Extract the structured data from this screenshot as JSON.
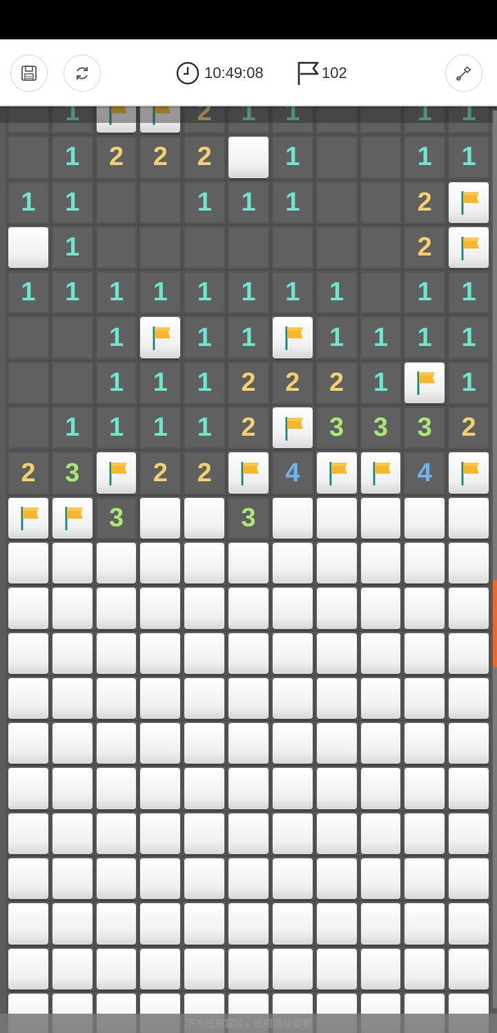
{
  "header": {
    "timer": "10:49:08",
    "flag_count": "102",
    "buttons": [
      {
        "name": "save-button",
        "icon": "save-icon"
      },
      {
        "name": "restart-button",
        "icon": "refresh-icon"
      },
      {
        "name": "shovel-button",
        "icon": "shovel-icon"
      }
    ]
  },
  "board": {
    "columns": 11,
    "legend": "rows: C = unopened, E = opened empty, F = flag, digit = opened number",
    "rows": [
      [
        "E",
        "1",
        "F",
        "F",
        "2",
        "1",
        "1",
        "E",
        "E",
        "1",
        "1"
      ],
      [
        "E",
        "1",
        "2",
        "2",
        "2",
        "C",
        "1",
        "E",
        "E",
        "1",
        "1"
      ],
      [
        "1",
        "1",
        "E",
        "E",
        "1",
        "1",
        "1",
        "E",
        "E",
        "2",
        "F"
      ],
      [
        "C",
        "1",
        "E",
        "E",
        "E",
        "E",
        "E",
        "E",
        "E",
        "2",
        "F"
      ],
      [
        "1",
        "1",
        "1",
        "1",
        "1",
        "1",
        "1",
        "1",
        "E",
        "1",
        "1"
      ],
      [
        "E",
        "E",
        "1",
        "F",
        "1",
        "1",
        "F",
        "1",
        "1",
        "1",
        "1"
      ],
      [
        "E",
        "E",
        "1",
        "1",
        "1",
        "2",
        "2",
        "2",
        "1",
        "F",
        "1"
      ],
      [
        "E",
        "1",
        "1",
        "1",
        "1",
        "2",
        "F",
        "3",
        "3",
        "3",
        "2"
      ],
      [
        "2",
        "3",
        "F",
        "2",
        "2",
        "F",
        "4",
        "F",
        "F",
        "4",
        "F"
      ],
      [
        "F",
        "F",
        "3",
        "C",
        "C",
        "3",
        "C",
        "C",
        "C",
        "C",
        "C"
      ],
      [
        "C",
        "C",
        "C",
        "C",
        "C",
        "C",
        "C",
        "C",
        "C",
        "C",
        "C"
      ],
      [
        "C",
        "C",
        "C",
        "C",
        "C",
        "C",
        "C",
        "C",
        "C",
        "C",
        "C"
      ],
      [
        "C",
        "C",
        "C",
        "C",
        "C",
        "C",
        "C",
        "C",
        "C",
        "C",
        "C"
      ],
      [
        "C",
        "C",
        "C",
        "C",
        "C",
        "C",
        "C",
        "C",
        "C",
        "C",
        "C"
      ],
      [
        "C",
        "C",
        "C",
        "C",
        "C",
        "C",
        "C",
        "C",
        "C",
        "C",
        "C"
      ],
      [
        "C",
        "C",
        "C",
        "C",
        "C",
        "C",
        "C",
        "C",
        "C",
        "C",
        "C"
      ],
      [
        "C",
        "C",
        "C",
        "C",
        "C",
        "C",
        "C",
        "C",
        "C",
        "C",
        "C"
      ],
      [
        "C",
        "C",
        "C",
        "C",
        "C",
        "C",
        "C",
        "C",
        "C",
        "C",
        "C"
      ],
      [
        "C",
        "C",
        "C",
        "C",
        "C",
        "C",
        "C",
        "C",
        "C",
        "C",
        "C"
      ],
      [
        "C",
        "C",
        "C",
        "C",
        "C",
        "C",
        "C",
        "C",
        "C",
        "C",
        "C"
      ],
      [
        "C",
        "C",
        "C",
        "C",
        "C",
        "C",
        "C",
        "C",
        "C",
        "C",
        "C"
      ],
      [
        "C",
        "C",
        "C",
        "C",
        "C",
        "C",
        "C",
        "C",
        "C",
        "C",
        "C"
      ]
    ]
  },
  "bottom_hint": "下方还有雷区，使用滑动查看",
  "colors": {
    "n1": "#6ee6cf",
    "n2": "#f2d06f",
    "n3": "#a8e876",
    "n4": "#6bb4ef",
    "scroll_thumb": "#f26522",
    "flag": "#f7b62b"
  }
}
